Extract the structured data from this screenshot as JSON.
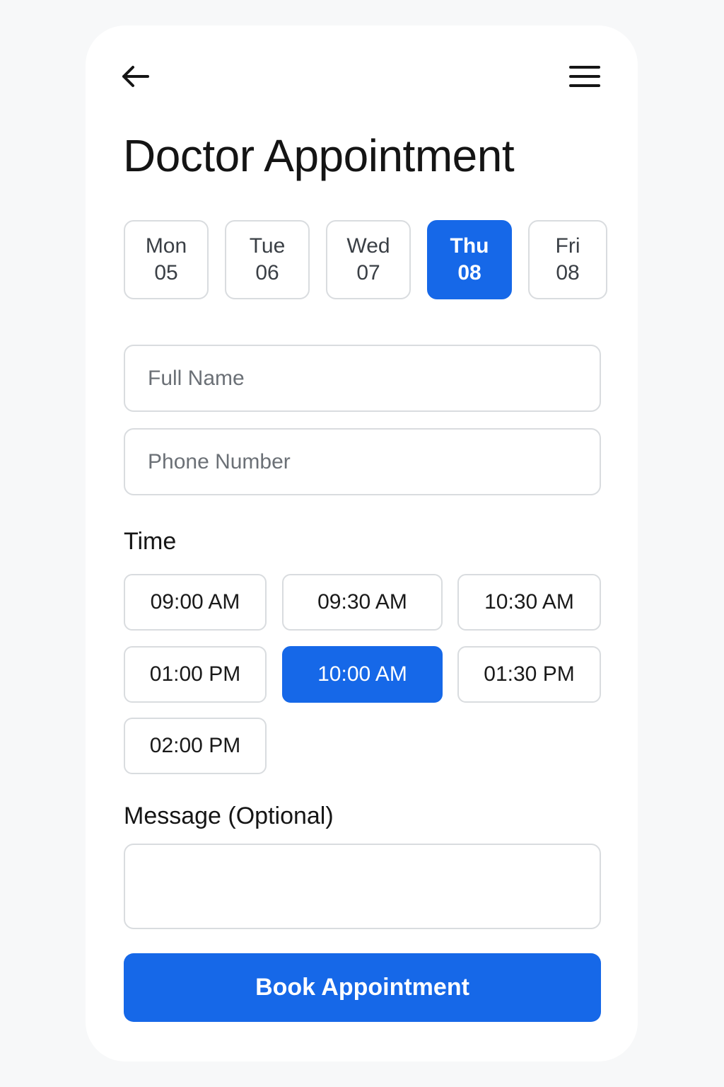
{
  "header": {
    "back_icon": "arrow-left-icon",
    "menu_icon": "hamburger-menu-icon"
  },
  "page_title": "Doctor Appointment",
  "dates": [
    {
      "day": "Mon",
      "num": "05",
      "selected": false
    },
    {
      "day": "Tue",
      "num": "06",
      "selected": false
    },
    {
      "day": "Wed",
      "num": "07",
      "selected": false
    },
    {
      "day": "Thu",
      "num": "08",
      "selected": true
    },
    {
      "day": "Fri",
      "num": "08",
      "selected": false
    }
  ],
  "form": {
    "full_name": {
      "placeholder": "Full Name",
      "value": ""
    },
    "phone": {
      "placeholder": "Phone Number",
      "value": ""
    },
    "time_label": "Time",
    "times": [
      {
        "label": "09:00 AM",
        "selected": false
      },
      {
        "label": "09:30 AM",
        "selected": false
      },
      {
        "label": "10:30 AM",
        "selected": false
      },
      {
        "label": "01:00 PM",
        "selected": false
      },
      {
        "label": "10:00 AM",
        "selected": true
      },
      {
        "label": "01:30 PM",
        "selected": false
      },
      {
        "label": "02:00 PM",
        "selected": false
      }
    ],
    "message_label": "Message (Optional)",
    "message": {
      "value": ""
    },
    "submit_label": "Book Appointment"
  },
  "colors": {
    "accent": "#1668e8",
    "border": "#d9dcdf",
    "background": "#f7f8f9",
    "card": "#ffffff"
  }
}
